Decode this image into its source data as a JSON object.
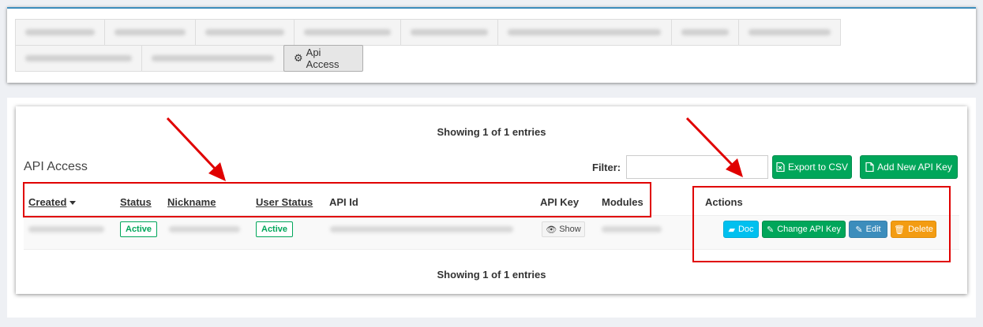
{
  "tabs": {
    "active_label": "Api Access"
  },
  "panel": {
    "title": "API Access",
    "showing_top": "Showing 1 of 1 entries",
    "showing_bottom": "Showing 1 of 1 entries",
    "filter_label": "Filter:",
    "filter_value": ""
  },
  "toolbar": {
    "export_label": "Export to CSV",
    "add_label": "Add New API Key"
  },
  "table": {
    "columns": [
      "Created",
      "Status",
      "Nickname",
      "User Status",
      "API Id",
      "API Key",
      "Modules",
      "Actions"
    ],
    "row": {
      "status": "Active",
      "user_status": "Active",
      "show_label": "Show"
    },
    "actions": [
      "Doc",
      "Change API Key",
      "Edit",
      "Delete"
    ]
  },
  "icons": {
    "gear": "gear-icon",
    "export": "file-export-icon",
    "add": "file-add-icon",
    "eye": "eye-icon",
    "book": "book-icon",
    "edit": "edit-icon",
    "trash": "trash-icon",
    "sort": "caret-down-icon"
  },
  "colors": {
    "success": "#00a65a",
    "info": "#00c0ef",
    "primary": "#3c8dbc",
    "warning": "#f39c12",
    "annotation": "#e00000"
  }
}
